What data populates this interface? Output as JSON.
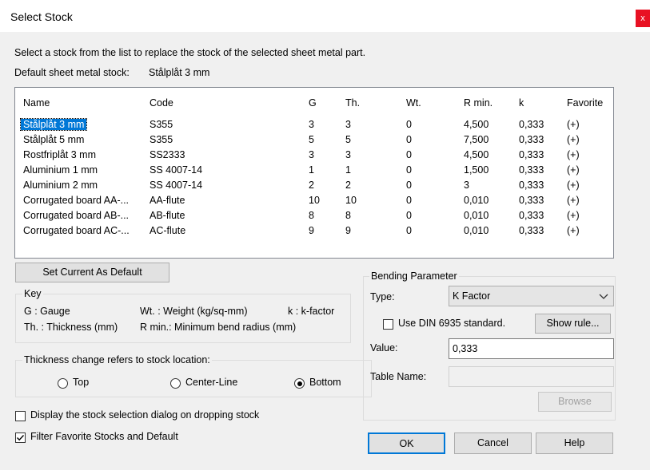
{
  "window": {
    "title": "Select Stock",
    "close_glyph": "x"
  },
  "intro": "Select a stock from the list to replace the stock of the selected sheet metal part.",
  "default_stock": {
    "label": "Default sheet metal stock:",
    "value": "Stålplåt 3 mm"
  },
  "table": {
    "headers": [
      "Name",
      "Code",
      "G",
      "Th.",
      "Wt.",
      "R min.",
      "k",
      "Favorite"
    ],
    "rows": [
      [
        "Stålplåt 3 mm",
        "S355",
        "3",
        "3",
        "0",
        "4,500",
        "0,333",
        "(+)"
      ],
      [
        "Stålplåt 5 mm",
        "S355",
        "5",
        "5",
        "0",
        "7,500",
        "0,333",
        "(+)"
      ],
      [
        "Rostfriplåt 3 mm",
        "SS2333",
        "3",
        "3",
        "0",
        "4,500",
        "0,333",
        "(+)"
      ],
      [
        "Aluminium 1 mm",
        "SS 4007-14",
        "1",
        "1",
        "0",
        "1,500",
        "0,333",
        "(+)"
      ],
      [
        "Aluminium 2 mm",
        "SS 4007-14",
        "2",
        "2",
        "0",
        "3",
        "0,333",
        "(+)"
      ],
      [
        "Corrugated board AA-...",
        "AA-flute",
        "10",
        "10",
        "0",
        "0,010",
        "0,333",
        "(+)"
      ],
      [
        "Corrugated board AB-...",
        "AB-flute",
        "8",
        "8",
        "0",
        "0,010",
        "0,333",
        "(+)"
      ],
      [
        "Corrugated board AC-...",
        "AC-flute",
        "9",
        "9",
        "0",
        "0,010",
        "0,333",
        "(+)"
      ]
    ],
    "selected_row": 0
  },
  "set_default_button": "Set Current As Default",
  "key": {
    "legend": "Key",
    "gauge": "G : Gauge",
    "weight": "Wt. : Weight (kg/sq-mm)",
    "kfactor": "k : k-factor",
    "thickness": "Th. : Thickness (mm)",
    "rmin": "R min.: Minimum bend radius (mm)"
  },
  "thickness_change": {
    "legend": "Thickness change refers to stock location:",
    "options": [
      "Top",
      "Center-Line",
      "Bottom"
    ],
    "selected": "Bottom"
  },
  "options": {
    "display_dialog": {
      "label": "Display the stock selection dialog on dropping stock",
      "checked": false
    },
    "filter_favorites": {
      "label": "Filter Favorite Stocks and Default",
      "checked": true
    }
  },
  "bending": {
    "legend": "Bending Parameter",
    "type_label": "Type:",
    "type_value": "K Factor",
    "din_label": "Use DIN 6935 standard.",
    "din_checked": false,
    "show_rule": "Show rule...",
    "value_label": "Value:",
    "value": "0,333",
    "table_name_label": "Table Name:",
    "table_name_value": "",
    "browse": "Browse"
  },
  "buttons": {
    "ok": "OK",
    "cancel": "Cancel",
    "help": "Help"
  },
  "colors": {
    "selection": "#0078d7",
    "close": "#e81123"
  }
}
